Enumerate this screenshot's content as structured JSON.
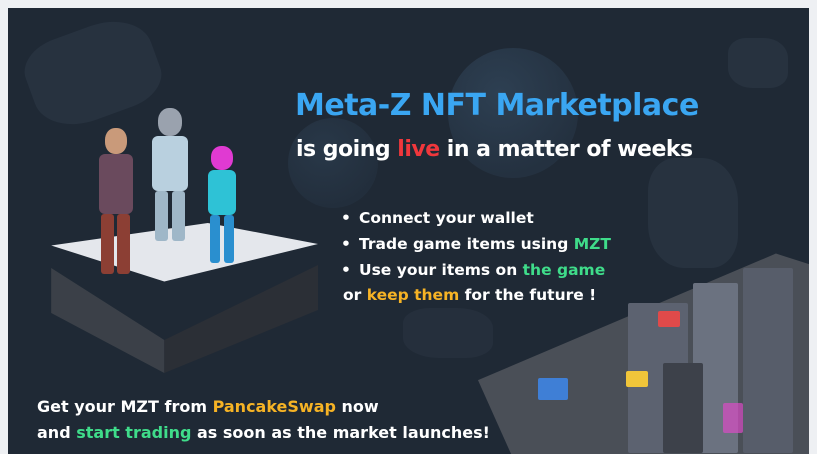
{
  "headline": {
    "title": "Meta-Z NFT Marketplace",
    "subtitle_pre": "is going ",
    "subtitle_live": "live",
    "subtitle_post": " in a matter of weeks"
  },
  "bullets": [
    {
      "pre": "Connect your wallet",
      "hl": "",
      "post": ""
    },
    {
      "pre": "Trade game items using ",
      "hl": "MZT",
      "post": ""
    },
    {
      "pre": "Use your items on ",
      "hl": "the game",
      "post": ""
    }
  ],
  "bullet_continuation": {
    "pre": "or ",
    "hl": "keep them",
    "post": " for the future !"
  },
  "footer": {
    "line1_pre": "Get your MZT from ",
    "line1_hl": "PancakeSwap",
    "line1_post": " now",
    "line2_pre": "and ",
    "line2_hl": "start trading",
    "line2_post": " as soon as the market launches!"
  },
  "colors": {
    "background": "#1f2935",
    "title": "#3aa6f2",
    "live": "#f0373c",
    "green": "#3fdc8a",
    "gold": "#f6b325"
  }
}
